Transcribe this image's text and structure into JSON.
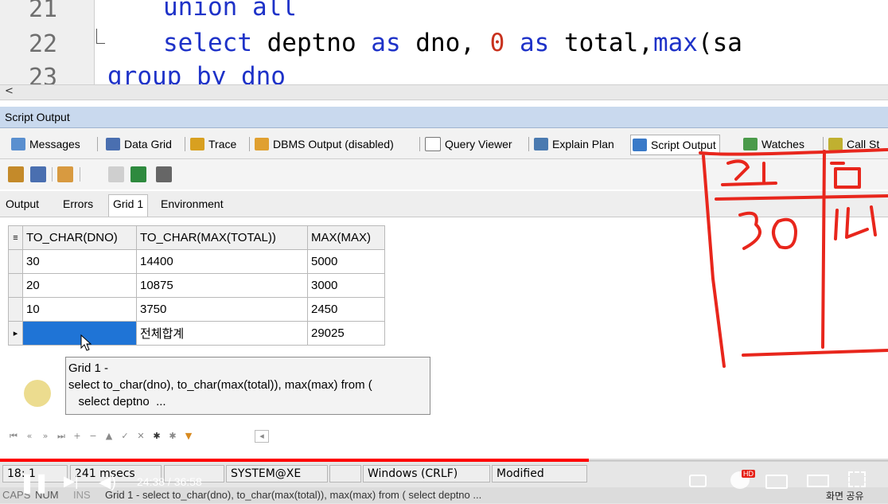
{
  "editor": {
    "lines": [
      {
        "num": "21",
        "pre": "   ",
        "kw1": "union all",
        "rest": ""
      },
      {
        "num": "22",
        "pre": "   ",
        "kw1": "select",
        "rest_a": " deptno ",
        "kw2": "as",
        "rest_b": " dno, ",
        "num_lit": "0",
        "rest_c": " ",
        "kw3": "as",
        "rest_d": " total,",
        "kw4": "max",
        "rest_e": "(sa"
      },
      {
        "num": "23",
        "text": "group by dno"
      }
    ],
    "scroll_left_glyph": "<"
  },
  "panel": {
    "title": "Script Output",
    "tabs": [
      {
        "label": "Messages",
        "icon": "messages-icon",
        "color": "#5a8fcf"
      },
      {
        "label": "Data Grid",
        "icon": "data-grid-icon",
        "color": "#4a6fb0"
      },
      {
        "label": "Trace",
        "icon": "trace-icon",
        "color": "#d8a020"
      },
      {
        "label": "DBMS Output (disabled)",
        "icon": "dbms-output-icon",
        "color": "#e0a030"
      },
      {
        "label": "Query Viewer",
        "icon": "query-viewer-icon",
        "color": "#8a8a8a"
      },
      {
        "label": "Explain Plan",
        "icon": "explain-plan-icon",
        "color": "#4a7ab0"
      },
      {
        "label": "Script Output",
        "icon": "script-output-icon",
        "color": "#3a7ac8"
      },
      {
        "label": "Watches",
        "icon": "watches-icon",
        "color": "#4a9a4a"
      },
      {
        "label": "Call St",
        "icon": "call-stack-icon",
        "color": "#c0b030"
      }
    ]
  },
  "subtabs": [
    "Output",
    "Errors",
    "Grid 1",
    "Environment"
  ],
  "grid": {
    "headers": [
      "TO_CHAR(DNO)",
      "TO_CHAR(MAX(TOTAL))",
      "MAX(MAX)"
    ],
    "rows": [
      [
        "30",
        "14400",
        "5000"
      ],
      [
        "20",
        "10875",
        "3000"
      ],
      [
        "10",
        "3750",
        "2450"
      ],
      [
        "",
        "전체합계",
        "29025"
      ]
    ],
    "current_row_marker": "▸"
  },
  "tooltip": {
    "line1": "Grid 1 -",
    "line2": "select to_char(dno), to_char(max(total)), max(max) from (",
    "line3": "   select deptno  ..."
  },
  "status": {
    "position": "18: 1",
    "timing": "241 msecs",
    "connection": "SYSTEM@XE",
    "line_endings": "Windows (CRLF)",
    "state": "Modified",
    "caps": "CAPS",
    "num": "NUM",
    "ins": "INS",
    "message": "Grid 1 - select to_char(dno), to_char(max(total)), max(max) from (  select deptno ..."
  },
  "player": {
    "time": "24:38 / 36:58",
    "progress_fraction": 0.663,
    "hd_badge": "HD",
    "caption": "화면 공유"
  },
  "annotation": {
    "header_left": "코드",
    "header_right": "합",
    "value_left": "30",
    "value_right": "14",
    "color": "#e8261c"
  }
}
